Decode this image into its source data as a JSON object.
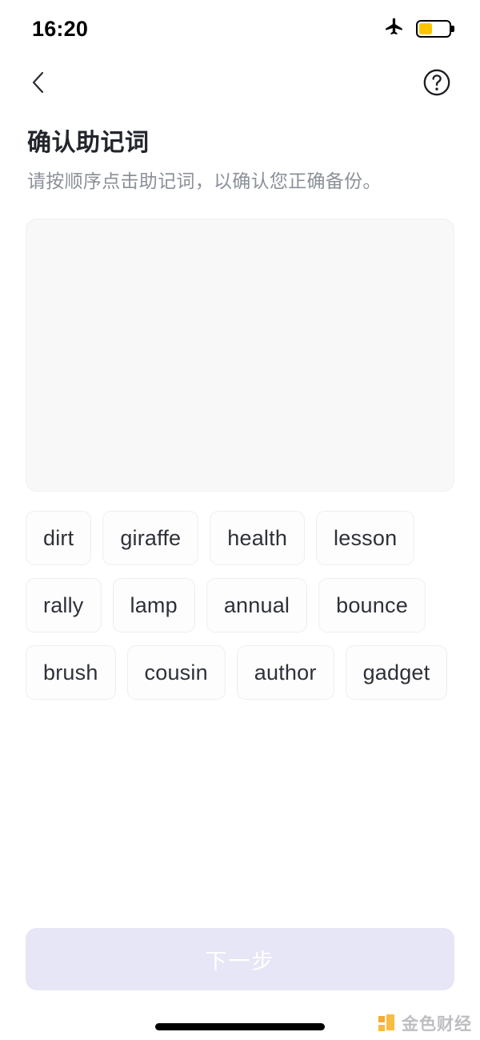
{
  "status_bar": {
    "time": "16:20",
    "airplane_icon": "airplane-mode-icon",
    "battery_icon": "battery-icon",
    "battery_level_percent": 45,
    "battery_color": "#fdc500"
  },
  "nav": {
    "back_icon": "chevron-left-icon",
    "help_icon": "help-circle-icon"
  },
  "header": {
    "title": "确认助记词",
    "subtitle": "请按顺序点击助记词，以确认您正确备份。"
  },
  "answer_area": {
    "selected_words": [],
    "background_color": "#f8f8f9"
  },
  "word_pool": {
    "words": [
      "dirt",
      "giraffe",
      "health",
      "lesson",
      "rally",
      "lamp",
      "annual",
      "bounce",
      "brush",
      "cousin",
      "author",
      "gadget"
    ]
  },
  "footer": {
    "next_label": "下一步",
    "next_disabled": true,
    "next_background": "#e7e6f6",
    "next_text_color": "#ffffff"
  },
  "watermark": {
    "text": "金色财经",
    "mark_color": "#f5a623"
  }
}
